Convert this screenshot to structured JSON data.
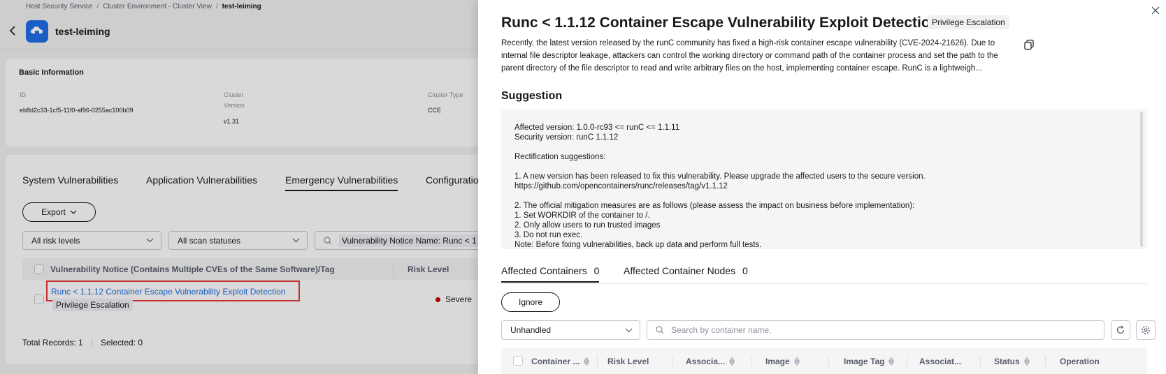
{
  "breadcrumb": [
    "Host Security Service",
    "Cluster Environment - Cluster View",
    "test-leiming"
  ],
  "page": {
    "title": "test-leiming"
  },
  "basic_info": {
    "title": "Basic Information",
    "id_label": "ID",
    "id_value": "eb8d2c33-1cf5-11f0-af96-0255ac100b09",
    "cluster_label": "Cluster",
    "version_label": "Version",
    "version_value": "v1.31",
    "cluster_type_label": "Cluster Type",
    "cluster_type_value": "CCE"
  },
  "vuln_tabs": [
    "System Vulnerabilities",
    "Application Vulnerabilities",
    "Emergency Vulnerabilities",
    "Configuratio"
  ],
  "export_label": "Export",
  "filters": {
    "risk": "All risk levels",
    "scan": "All scan statuses",
    "search_value": "Vulnerability Notice Name: Runc < 1"
  },
  "table": {
    "col1": "Vulnerability Notice (Contains Multiple CVEs of the Same Software)/Tag",
    "col2": "Risk Level",
    "row": {
      "name": "Runc < 1.1.12 Container Escape Vulnerability Exploit Detection",
      "tag": "Privilege Escalation",
      "risk": "Severe"
    }
  },
  "footer": {
    "total": "Total Records: 1",
    "selected": "Selected: 0"
  },
  "drawer": {
    "title": "Runc < 1.1.12 Container Escape Vulnerability Exploit Detection",
    "tag": "Privilege Escalation",
    "description": "Recently, the latest version released by the runC community has fixed a high-risk container escape vulnerability (CVE-2024-21626). Due to internal file descriptor leakage, attackers can control the working directory or command path of the container process and set the path to the parent directory of the file descriptor to read and write arbitrary files on the host, implementing container escape. RunC is a lightweigh...",
    "suggestion_title": "Suggestion",
    "suggestion_text": "Affected version: 1.0.0-rc93 <= runC <= 1.1.11\nSecurity version: runC 1.1.12\n\nRectification suggestions:\n\n1. A new version has been released to fix this vulnerability. Please upgrade the affected users to the secure version.\nhttps://github.com/opencontainers/runc/releases/tag/v1.1.12\n\n2. The official mitigation measures are as follows (please assess the impact on business before implementation):\n1. Set WORKDIR of the container to /.\n2. Only allow users to run trusted images\n3. Do not run exec.\nNote: Before fixing vulnerabilities, back up data and perform full tests.",
    "tabs": [
      {
        "label": "Affected Containers",
        "count": "0"
      },
      {
        "label": "Affected Container Nodes",
        "count": "0"
      }
    ],
    "ignore_label": "Ignore",
    "status_select": "Unhandled",
    "search_placeholder": "Search by container name.",
    "columns": [
      "Container ...",
      "Risk Level",
      "Associa...",
      "Image",
      "Image Tag",
      "Associat...",
      "Status",
      "Operation"
    ]
  },
  "colors": {
    "accent": "#1f6fe8",
    "severe": "#c7000b",
    "highlight": "#e53935"
  }
}
